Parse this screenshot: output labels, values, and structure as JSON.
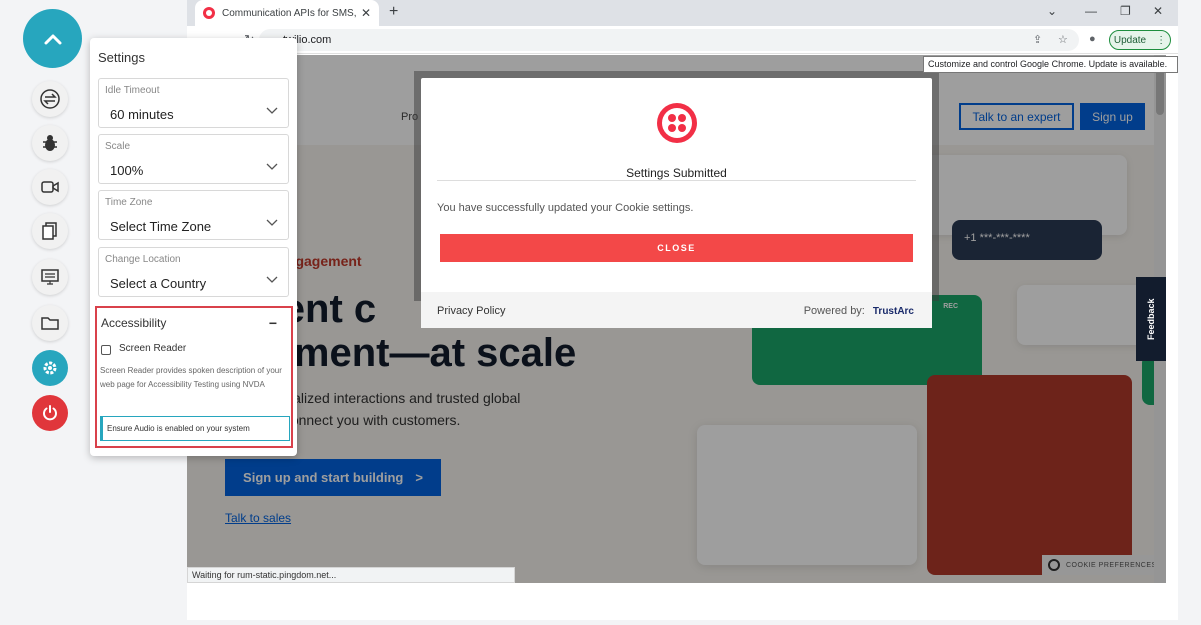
{
  "browser": {
    "tab_title": "Communication APIs for SMS, Vo",
    "url": "twilio.com",
    "update_label": "Update",
    "tooltip": "Customize and control Google Chrome. Update is available.",
    "status_text": "Waiting for rum-static.pingdom.net..."
  },
  "page": {
    "nav_fragment": "Pro",
    "talk_expert": "Talk to an expert",
    "signup": "Sign up",
    "hero_kicker": "stomer Engagement",
    "hero_line1": "lligent c",
    "hero_line2": "agement—at scale",
    "hero_body1": "ers personalized interactions and trusted global",
    "hero_body2": "ations to connect you with customers.",
    "cta_label": "Sign up and start building",
    "cta_arrow": ">",
    "talk_sales": "Talk to sales",
    "card_dark_text": "+1   ***-***-****",
    "card_rec": "REC",
    "cookie_prefs": "COOKIE PREFERENCES",
    "feedback": "Feedback"
  },
  "modal": {
    "title": "Settings Submitted",
    "message": "You have successfully updated your Cookie settings.",
    "close_label": "CLOSE",
    "privacy_policy": "Privacy Policy",
    "powered_by": "Powered by:",
    "brand": "TrustArc"
  },
  "settings": {
    "title": "Settings",
    "idle_timeout": {
      "label": "Idle Timeout",
      "value": "60 minutes"
    },
    "scale": {
      "label": "Scale",
      "value": "100%"
    },
    "time_zone": {
      "label": "Time Zone",
      "value": "Select Time Zone"
    },
    "location": {
      "label": "Change Location",
      "value": "Select a Country"
    },
    "accessibility": {
      "title": "Accessibility",
      "toggle": "−",
      "screen_reader_label": "Screen Reader",
      "screen_reader_checked": false,
      "description": "Screen Reader provides spoken description of your web page for Accessibility Testing using NVDA",
      "audio_note": "Ensure Audio is enabled on your system"
    }
  },
  "rail": {
    "icons": [
      "chevron-up-icon",
      "swap-icon",
      "bug-icon",
      "video-icon",
      "copy-icon",
      "monitor-icon",
      "folder-icon",
      "gear-icon",
      "power-icon"
    ]
  },
  "colors": {
    "accent": "#27a6be",
    "danger": "#e0363b",
    "twilio_red": "#f22f46",
    "link_blue": "#0263e0",
    "close_red": "#f34848"
  }
}
